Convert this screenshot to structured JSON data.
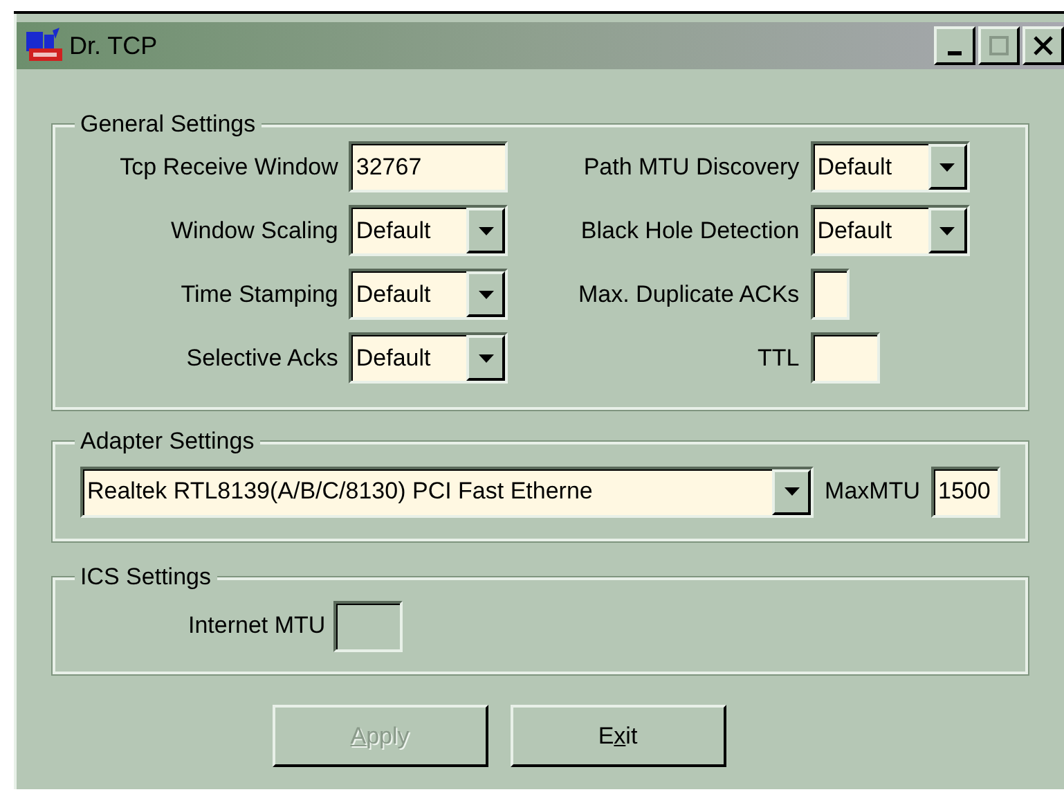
{
  "window": {
    "title": "Dr. TCP"
  },
  "general_settings": {
    "title": "General Settings",
    "left": [
      {
        "label": "Tcp Receive Window",
        "kind": "text",
        "value": "32767",
        "disabled": false
      },
      {
        "label": "Window Scaling",
        "kind": "dropdown",
        "value": "Default",
        "disabled": false
      },
      {
        "label": "Time Stamping",
        "kind": "dropdown",
        "value": "Default",
        "disabled": false
      },
      {
        "label": "Selective Acks",
        "kind": "dropdown",
        "value": "Default",
        "disabled": false
      }
    ],
    "right": [
      {
        "label": "Path MTU Discovery",
        "kind": "dropdown",
        "value": "Default",
        "disabled": false
      },
      {
        "label": "Black Hole Detection",
        "kind": "dropdown",
        "value": "Default",
        "disabled": false
      },
      {
        "label": "Max. Duplicate ACKs",
        "kind": "small_text",
        "disabled": false
      },
      {
        "label": "TTL",
        "kind": "medium_text",
        "disabled": false
      }
    ]
  },
  "adapter_settings": {
    "title": "Adapter Settings",
    "adapter": {
      "kind": "wide_dropdown",
      "value": "Realtek RTL8139(A/B/C/8130) PCI Fast Etherne",
      "disabled": false
    },
    "max_mtu": {
      "label": "MaxMTU",
      "kind": "medium_text",
      "value": "1500",
      "disabled": false
    }
  },
  "ics_settings": {
    "title": "ICS Settings",
    "fields": [
      {
        "label": "Internet MTU",
        "kind": "medium_text",
        "disabled": true
      }
    ]
  },
  "buttons": [
    {
      "accelerator": "A",
      "after": "pply",
      "disabled": true
    },
    {
      "before": "E",
      "accelerator": "x",
      "after": "it",
      "disabled": false
    }
  ]
}
